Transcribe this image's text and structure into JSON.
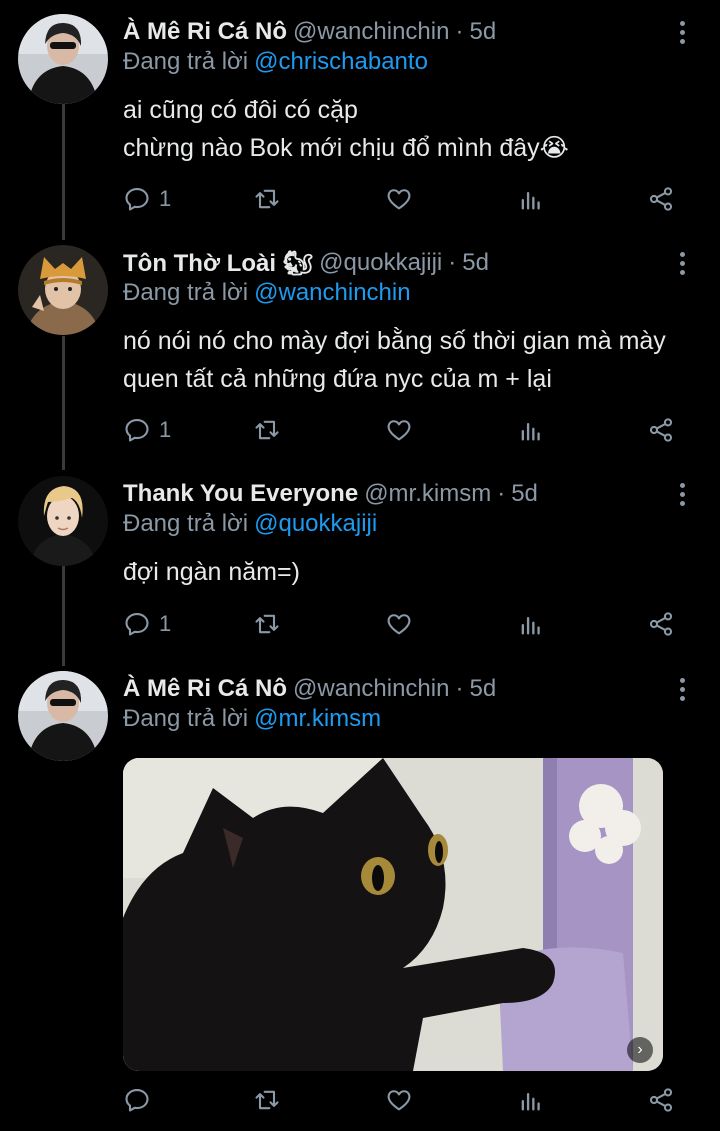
{
  "tweets": [
    {
      "name": "À Mê Ri Cá Nô",
      "handle": "@wanchinchin",
      "dot": "·",
      "time": "5d",
      "replying_label": "Đang trả lời",
      "replying_to": "@chrischabanto",
      "lines": [
        "ai cũng có đôi có cặp",
        "chừng nào Bok mới chịu đổ mình đây😭"
      ],
      "reply_count": "1"
    },
    {
      "name": "Tôn Thờ Loài 🐿",
      "handle": "@quokkajiji",
      "dot": "·",
      "time": "5d",
      "replying_label": "Đang trả lời",
      "replying_to": "@wanchinchin",
      "lines": [
        "nó nói nó cho mày đợi bằng số thời gian mà mày",
        "quen tất cả những đứa nyc của m + lại"
      ],
      "reply_count": "1"
    },
    {
      "name": "Thank You Everyone",
      "handle": "@mr.kimsm",
      "dot": "·",
      "time": "5d",
      "replying_label": "Đang trả lời",
      "replying_to": "@quokkajiji",
      "lines": [
        "đợi ngàn năm=)"
      ],
      "reply_count": "1"
    },
    {
      "name": "À Mê Ri Cá Nô",
      "handle": "@wanchinchin",
      "dot": "·",
      "time": "5d",
      "replying_label": "Đang trả lời",
      "replying_to": "@mr.kimsm",
      "lines": [],
      "reply_count": ""
    }
  ],
  "media_badge": "›",
  "icons": [
    "reply-icon",
    "retweet-icon",
    "like-icon",
    "analytics-icon",
    "share-icon",
    "more-icon"
  ],
  "colors": {
    "background": "#000000",
    "text": "#e7e9ea",
    "muted": "#8b98a5",
    "link": "#1d9bf0"
  }
}
